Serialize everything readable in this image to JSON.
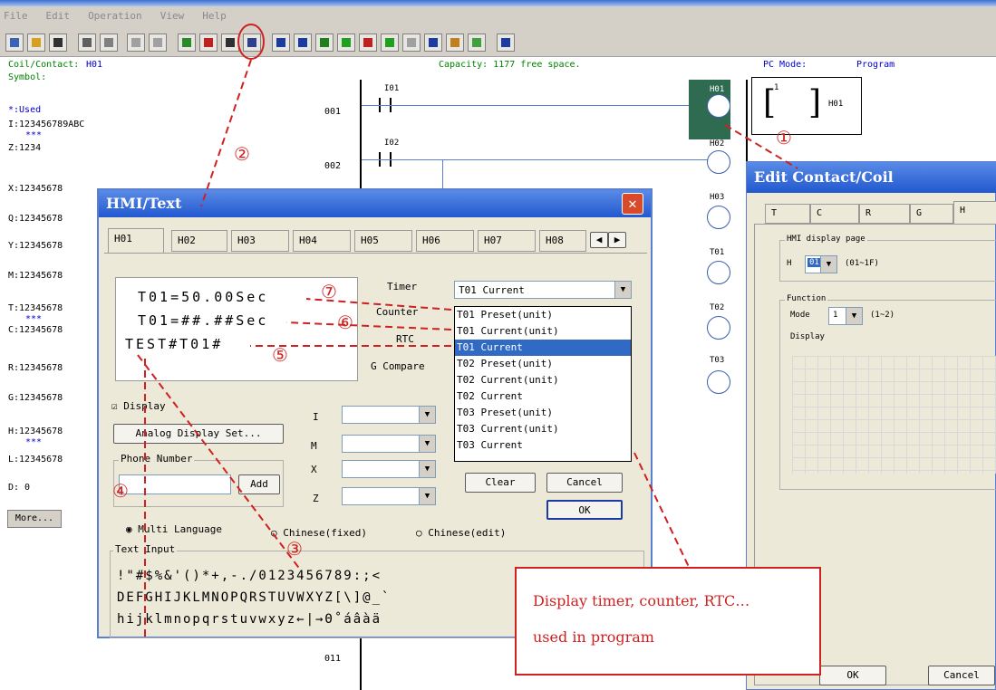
{
  "menu": [
    "File",
    "Edit",
    "Operation",
    "View",
    "Help"
  ],
  "info": {
    "coil_label": "Coil/Contact:",
    "coil_value": "H01",
    "symbol_label": "Symbol:",
    "capacity": "Capacity: 1177 free space.",
    "pc_mode_label": "PC Mode:",
    "pc_mode_value": "Program"
  },
  "left_panel": {
    "used": "*:Used",
    "lines": [
      "I:123456789ABC",
      "***",
      "Z:1234",
      "X:12345678",
      "Q:12345678",
      "Y:12345678",
      "M:12345678",
      "T:12345678",
      "***",
      "C:12345678",
      "R:12345678",
      "G:12345678",
      "H:12345678",
      "***",
      "L:12345678",
      "D: 0"
    ],
    "more_button": "More..."
  },
  "ladder": {
    "rows": [
      "001",
      "002",
      "011"
    ],
    "contacts": [
      "I01",
      "I02"
    ],
    "coils": [
      "H01",
      "H02",
      "H03",
      "T01",
      "T02",
      "T03"
    ],
    "coil_box_num": "1",
    "coil_box_label": "H01"
  },
  "hmi_dialog": {
    "title": "HMI/Text",
    "tabs": [
      "H01",
      "H02",
      "H03",
      "H04",
      "H05",
      "H06",
      "H07",
      "H08"
    ],
    "preview_lines": [
      "T01=50.00Sec",
      "T01=##.##Sec",
      "TEST#T01#"
    ],
    "labels": {
      "timer": "Timer",
      "counter": "Counter",
      "rtc": "RTC",
      "g_compare": "G Compare",
      "display": "Display",
      "analog": "Analog Display Set...",
      "phone": "Phone Number",
      "add": "Add",
      "i": "I",
      "m": "M",
      "x": "X",
      "z": "Z",
      "clear": "Clear",
      "cancel": "Cancel",
      "ok": "OK",
      "multi": "Multi Language",
      "chinese_fixed": "Chinese(fixed)",
      "chinese_edit": "Chinese(edit)",
      "text_input": "Text Input"
    },
    "timer_selected": "T01 Current",
    "dropdown_items": [
      "T01 Preset(unit)",
      "T01 Current(unit)",
      "T01 Current",
      "T02 Preset(unit)",
      "T02 Current(unit)",
      "T02 Current",
      "T03 Preset(unit)",
      "T03 Current(unit)",
      "T03 Current"
    ],
    "text_input_lines": [
      " !\"#$%&'()*+,-./0123456789:;<",
      "DEFGHIJKLMNOPQRSTUVWXYZ[\\]@_`",
      "hijklmnopqrstuvwxyz←|→Θ˚áâàä"
    ]
  },
  "edit_dialog": {
    "title": "Edit Contact/Coil",
    "tabs": [
      "T",
      "C",
      "R",
      "G",
      "H"
    ],
    "hmi_page_label": "HMI display page",
    "h_label": "H",
    "h_value": "01",
    "h_range": "(01~1F)",
    "function_label": "Function",
    "mode_label": "Mode",
    "mode_value": "1",
    "mode_range": "(1~2)",
    "display_label": "Display",
    "ok": "OK",
    "cancel": "Cancel"
  },
  "callout": {
    "line1": "Display timer, counter, RTC…",
    "line2": "used in program"
  },
  "annotations": [
    "①",
    "②",
    "③",
    "④",
    "⑤",
    "⑥",
    "⑦"
  ]
}
